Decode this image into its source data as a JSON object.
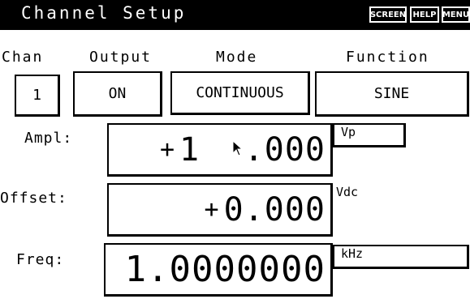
{
  "header": {
    "title": "Channel Setup",
    "softkeys": {
      "screen": "SCREEN",
      "help": "HELP",
      "menu": "MENU"
    }
  },
  "columns": {
    "chan": "Chan",
    "output": "Output",
    "mode": "Mode",
    "function": "Function"
  },
  "controls": {
    "chan": "1",
    "output": "ON",
    "mode": "CONTINUOUS",
    "function": "SINE"
  },
  "ampl": {
    "label": "Ampl:",
    "sign": "+",
    "digits_a": "1",
    "digits_b": ".000",
    "unit": "Vp"
  },
  "offset": {
    "label": "Offset:",
    "sign": "+",
    "digits": "0.000",
    "unit": "Vdc"
  },
  "freq": {
    "label": "Freq:",
    "digits": "1.0000000",
    "unit": "kHz"
  },
  "icons": {
    "cursor": "mouse-pointer-icon"
  }
}
